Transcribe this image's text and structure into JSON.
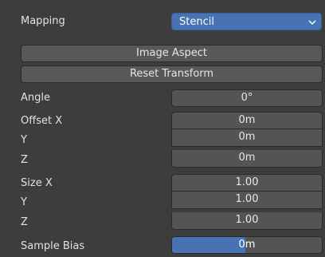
{
  "mapping": {
    "label": "Mapping",
    "value": "Stencil"
  },
  "buttons": {
    "image_aspect": "Image Aspect",
    "reset_transform": "Reset Transform"
  },
  "angle": {
    "label": "Angle",
    "value": "0°"
  },
  "offset": {
    "x_label": "Offset X",
    "x_value": "0m",
    "y_label": "Y",
    "y_value": "0m",
    "z_label": "Z",
    "z_value": "0m"
  },
  "size": {
    "x_label": "Size X",
    "x_value": "1.00",
    "y_label": "Y",
    "y_value": "1.00",
    "z_label": "Z",
    "z_value": "1.00"
  },
  "sample_bias": {
    "label": "Sample Bias",
    "value": "0m",
    "fill_fraction": 0.49
  },
  "colors": {
    "accent": "#4772b3",
    "panel_bg": "#3d3d3d",
    "field_bg": "#545454",
    "button_bg": "#585858"
  },
  "icons": {
    "dropdown": "chevron-down-icon"
  }
}
